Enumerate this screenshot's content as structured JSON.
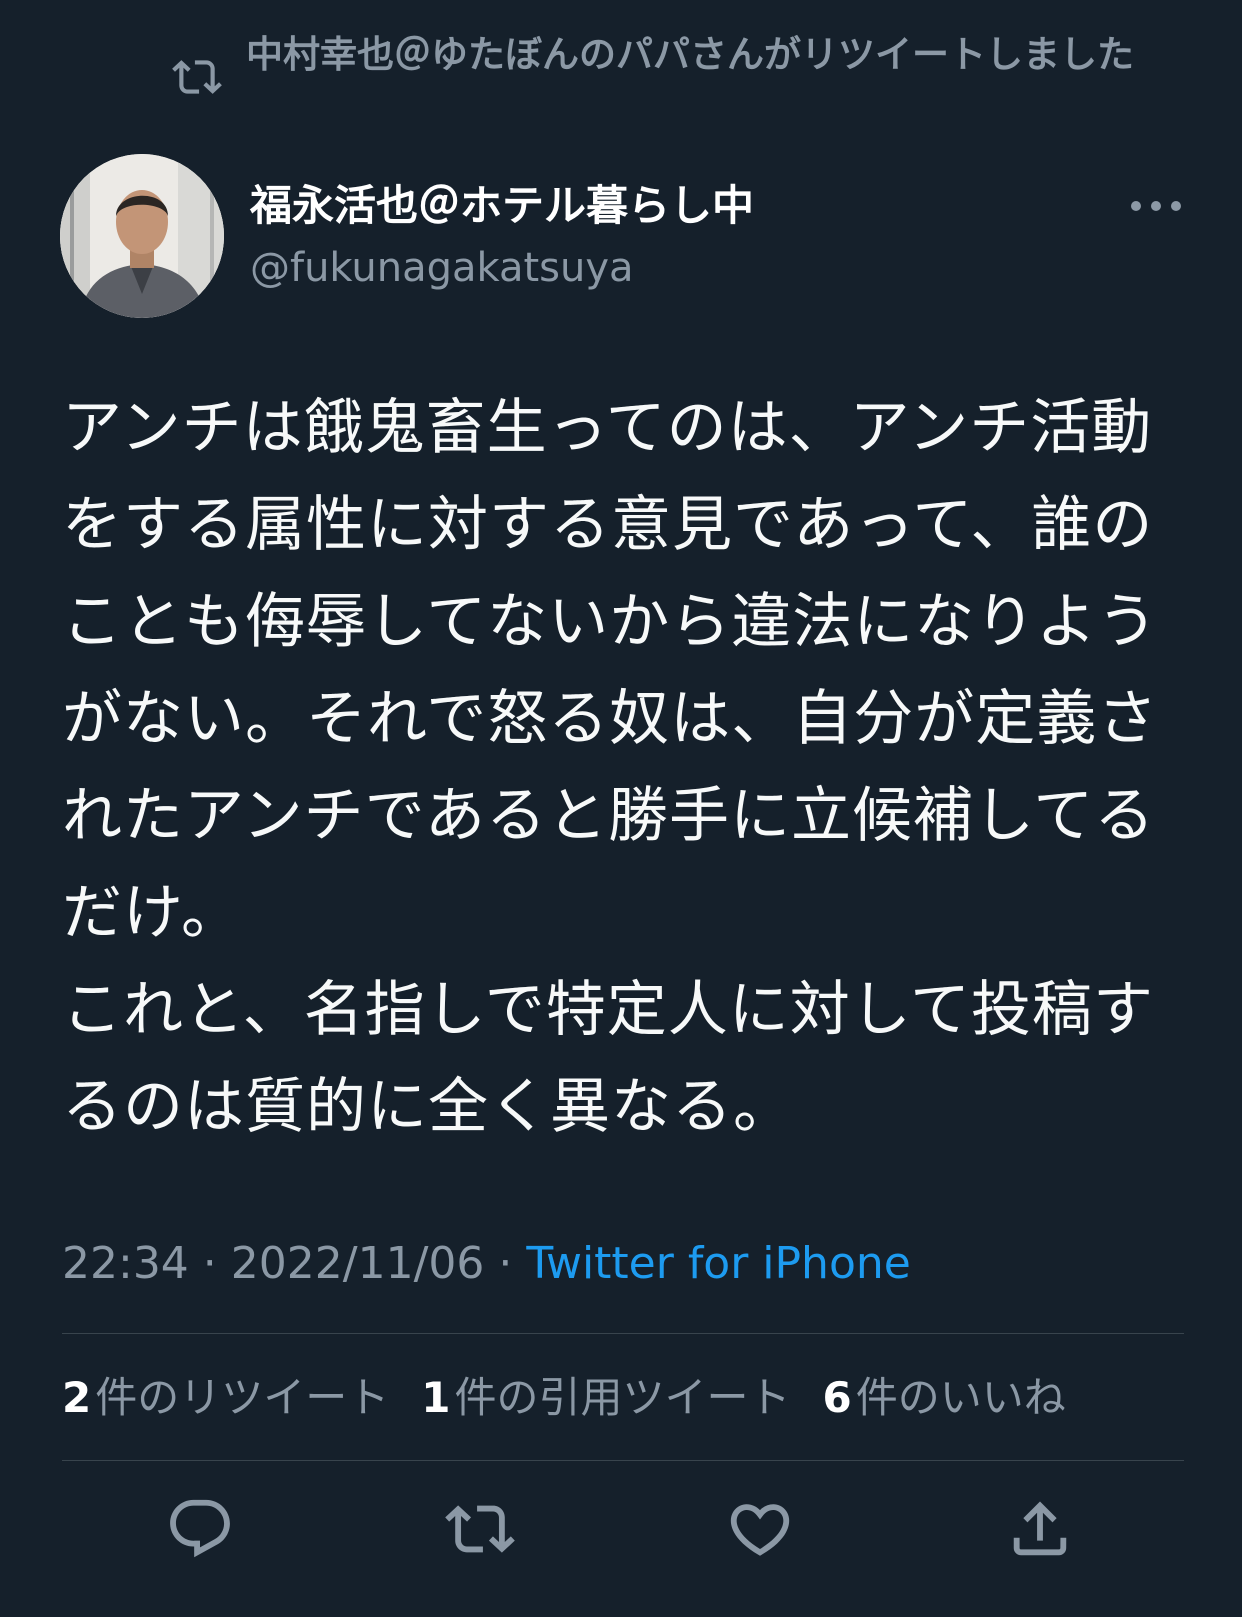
{
  "retweet_notice": {
    "text": "中村幸也＠ゆたぼんのパパさんがリツイートしました",
    "icon": "retweet-icon"
  },
  "author": {
    "display_name": "福永活也＠ホテル暮らし中",
    "handle": "@fukunagakatsuya"
  },
  "more_icon": "more-options-icon",
  "tweet": {
    "text": "アンチは餓鬼畜生ってのは、アンチ活動をする属性に対する意見であって、誰のことも侮辱してないから違法になりようがない。それで怒る奴は、自分が定義されたアンチであると勝手に立候補してるだけ。\nこれと、名指しで特定人に対して投稿するのは質的に全く異なる。"
  },
  "meta": {
    "time": "22:34",
    "separator": " · ",
    "date": "2022/11/06",
    "source": "Twitter for iPhone"
  },
  "stats": {
    "retweets_count": "2",
    "retweets_label": "件のリツイート",
    "quotes_count": "1",
    "quotes_label": "件の引用ツイート",
    "likes_count": "6",
    "likes_label": "件のいいね"
  },
  "actions": [
    "reply-icon",
    "retweet-icon",
    "like-icon",
    "share-icon"
  ],
  "colors": {
    "background": "#15202b",
    "secondary_text": "#8b98a5",
    "link": "#1d9bf0",
    "divider": "#38444d"
  }
}
